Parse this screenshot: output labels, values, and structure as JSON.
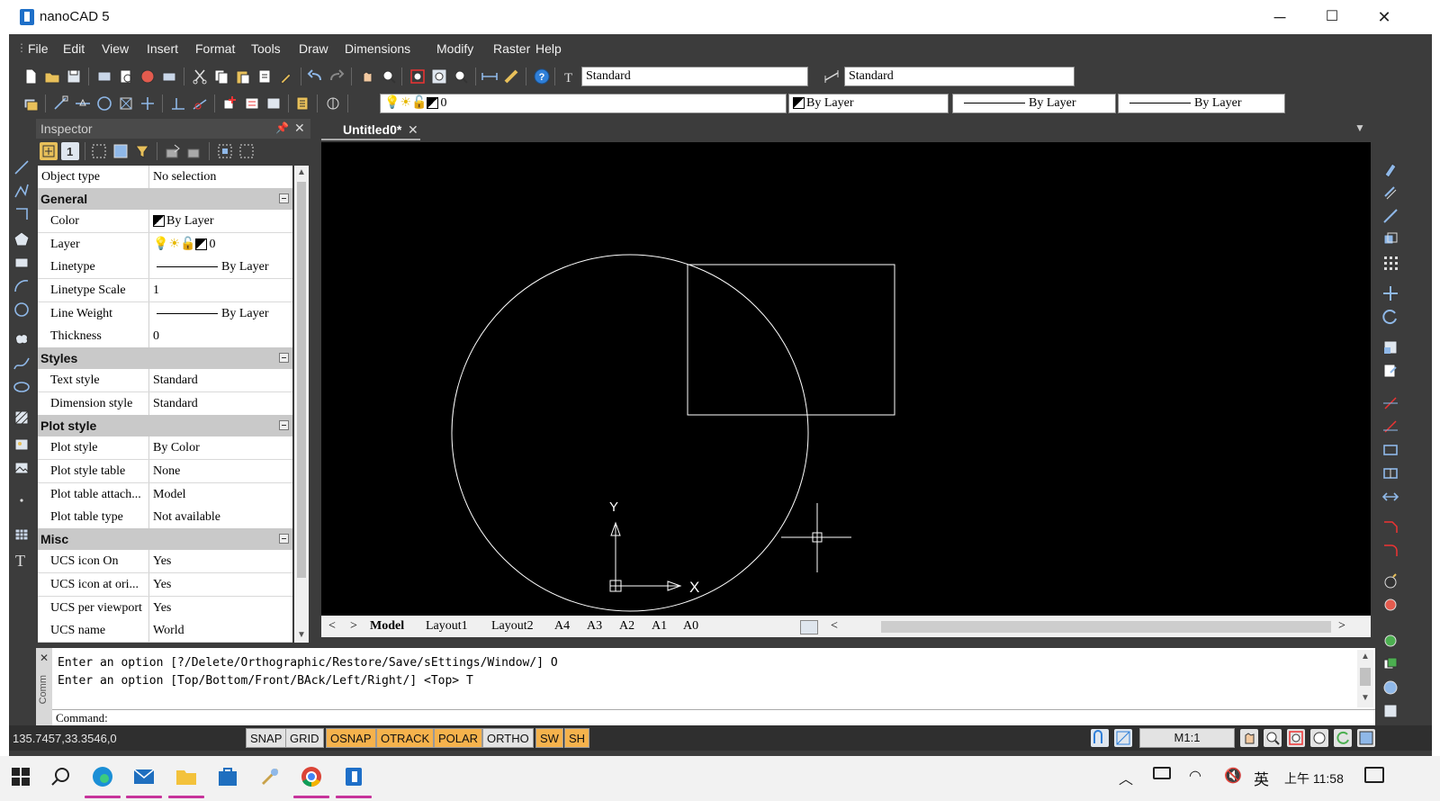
{
  "window": {
    "title": "nanoCAD 5",
    "minimize": "─",
    "maximize": "☐",
    "close": "✕"
  },
  "menu": [
    "File",
    "Edit",
    "View",
    "Insert",
    "Format",
    "Tools",
    "Draw",
    "Dimensions",
    "Modify",
    "Raster",
    "Help"
  ],
  "toolbar": {
    "text_style": "Standard",
    "dim_style": "Standard",
    "layer_value": "0",
    "color_value": "By Layer",
    "linetype_value": "By Layer",
    "lineweight_value": "By Layer"
  },
  "inspector": {
    "title": "Inspector",
    "object_type_label": "Object type",
    "object_type_value": "No selection",
    "groups": {
      "general": "General",
      "styles": "Styles",
      "plot_style": "Plot style",
      "misc": "Misc"
    },
    "general": [
      {
        "name": "Color",
        "value": "By Layer"
      },
      {
        "name": "Layer",
        "value": "0"
      },
      {
        "name": "Linetype",
        "value": "By Layer"
      },
      {
        "name": "Linetype Scale",
        "value": "1"
      },
      {
        "name": "Line Weight",
        "value": "By Layer"
      },
      {
        "name": "Thickness",
        "value": "0"
      }
    ],
    "styles": [
      {
        "name": "Text style",
        "value": "Standard"
      },
      {
        "name": "Dimension style",
        "value": "Standard"
      }
    ],
    "plot_style": [
      {
        "name": "Plot style",
        "value": "By Color"
      },
      {
        "name": "Plot style table",
        "value": "None"
      },
      {
        "name": "Plot table attach...",
        "value": "Model"
      },
      {
        "name": "Plot table type",
        "value": "Not available"
      }
    ],
    "misc": [
      {
        "name": "UCS icon On",
        "value": "Yes"
      },
      {
        "name": "UCS icon at ori...",
        "value": "Yes"
      },
      {
        "name": "UCS per viewport",
        "value": "Yes"
      },
      {
        "name": "UCS name",
        "value": "World"
      }
    ]
  },
  "document": {
    "tab": "Untitled0*",
    "ucs_y": "Y",
    "ucs_x": "X"
  },
  "layout_tabs": [
    "Model",
    "Layout1",
    "Layout2",
    "A4",
    "A3",
    "A2",
    "A1",
    "A0"
  ],
  "command": {
    "lines": [
      "Enter an option [?/Delete/Orthographic/Restore/Save/sEttings/Window/] O",
      "Enter an option [Top/Bottom/Front/BAck/Left/Right/] <Top> T"
    ],
    "prompt": "Command:",
    "side_label": "Comm"
  },
  "status": {
    "coords": "135.7457,33.3546,0",
    "toggles": [
      {
        "label": "SNAP",
        "on": false
      },
      {
        "label": "GRID",
        "on": false
      },
      {
        "label": "OSNAP",
        "on": true
      },
      {
        "label": "OTRACK",
        "on": true
      },
      {
        "label": "POLAR",
        "on": true
      },
      {
        "label": "ORTHO",
        "on": false
      },
      {
        "label": "SW",
        "on": true
      },
      {
        "label": "SH",
        "on": true
      }
    ],
    "scale": "M1:1"
  },
  "taskbar": {
    "ime": "英",
    "clock": "上午 11:58"
  },
  "colors": {
    "frame": "#3c3c3c",
    "canvas": "#000000",
    "toggle_on": "#f5b24c",
    "accent": "#1e6fc8"
  }
}
